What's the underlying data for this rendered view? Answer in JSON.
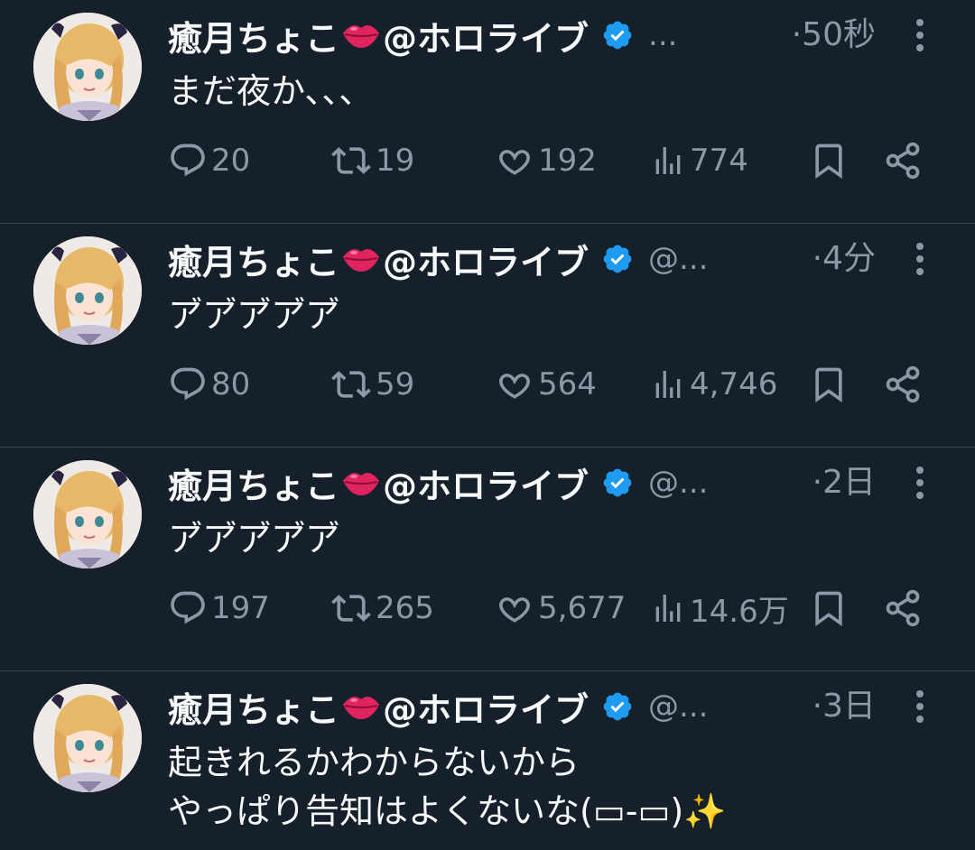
{
  "colors": {
    "background": "#15202b",
    "text_primary": "#f7f9f9",
    "text_secondary": "#8b98a5",
    "verified_blue": "#1d9bf0",
    "divider": "#38444d"
  },
  "tweets": [
    {
      "name": "癒月ちょこ",
      "name_suffix": "@ホロライブ",
      "handle": "...",
      "time": "·50秒",
      "text": "まだ夜か、、、",
      "reply_count": "20",
      "retweet_count": "19",
      "like_count": "192",
      "view_count": "774"
    },
    {
      "name": "癒月ちょこ",
      "name_suffix": "@ホロライブ",
      "handle": "@...",
      "time": "·4分",
      "text": "ア゙ア゙ア゙ア゙ア゙",
      "reply_count": "80",
      "retweet_count": "59",
      "like_count": "564",
      "view_count": "4,746"
    },
    {
      "name": "癒月ちょこ",
      "name_suffix": "@ホロライブ",
      "handle": "@...",
      "time": "·2日",
      "text": "ア゙ア゙ア゙ア゙ア゙",
      "reply_count": "197",
      "retweet_count": "265",
      "like_count": "5,677",
      "view_count": "14.6万"
    },
    {
      "name": "癒月ちょこ",
      "name_suffix": "@ホロライブ",
      "handle": "@...",
      "time": "·3日",
      "text": "起きれるかわからないから\nやっぱり告知はよくないな(▭-▭)✨",
      "reply_count": "",
      "retweet_count": "",
      "like_count": "",
      "view_count": ""
    }
  ],
  "icons": {
    "avatar": "vtuber-avatar",
    "lips": "lips-emoji",
    "verified": "verified-badge-icon",
    "more": "more-vertical-icon",
    "reply": "reply-icon",
    "retweet": "retweet-icon",
    "like": "heart-icon",
    "views": "views-icon",
    "bookmark": "bookmark-icon",
    "share": "share-icon"
  }
}
